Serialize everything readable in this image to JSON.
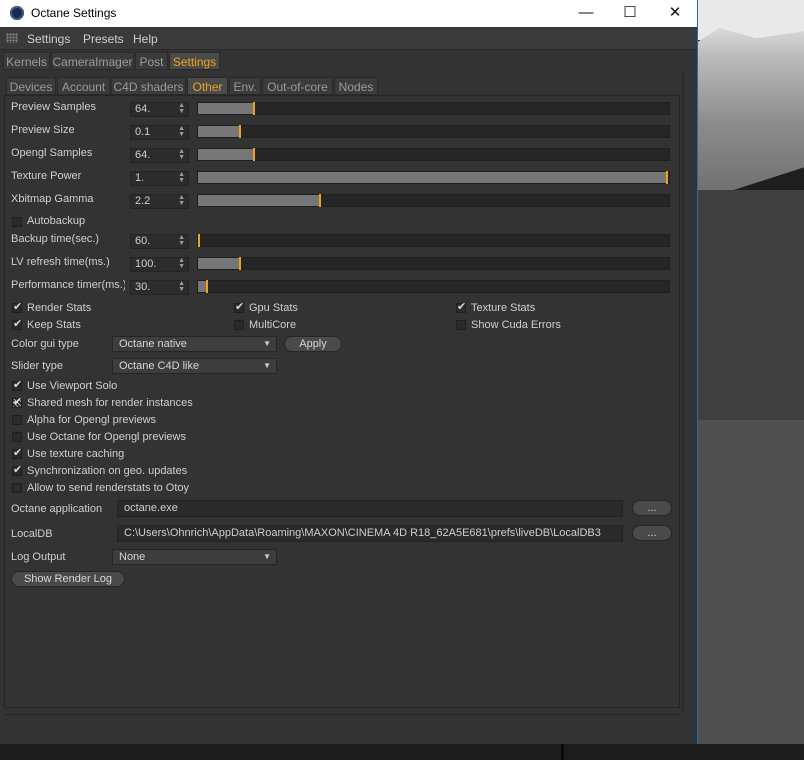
{
  "window": {
    "title": "Octane Settings",
    "minimize": "—",
    "maximize": "☐",
    "close": "✕"
  },
  "menubar": {
    "items": [
      "Settings",
      "Presets",
      "Help"
    ]
  },
  "main_tabs": [
    "Kernels",
    "CameraImager",
    "Post",
    "Settings"
  ],
  "main_tab_active": "Settings",
  "sub_tabs": [
    "Devices",
    "Account",
    "C4D shaders",
    "Other",
    "Env.",
    "Out-of-core",
    "Nodes"
  ],
  "sub_tab_active": "Other",
  "sliders": [
    {
      "label": "Preview Samples",
      "value": "64.",
      "fraction": 0.12
    },
    {
      "label": "Preview Size",
      "value": "0.1",
      "fraction": 0.09
    },
    {
      "label": "Opengl Samples",
      "value": "64.",
      "fraction": 0.12
    },
    {
      "label": "Texture Power",
      "value": "1.",
      "fraction": 1.0
    },
    {
      "label": "Xbitmap Gamma",
      "value": "2.2",
      "fraction": 0.26
    }
  ],
  "autobackup": {
    "label": "Autobackup",
    "checked": false
  },
  "sliders2": [
    {
      "label": "Backup time(sec.)",
      "value": "60.",
      "fraction": 0.0
    },
    {
      "label": "LV refresh time(ms.)",
      "value": "100.",
      "fraction": 0.09
    },
    {
      "label": "Performance timer(ms.)",
      "value": "30.",
      "fraction": 0.02
    }
  ],
  "stats": {
    "render_stats": {
      "label": "Render Stats",
      "checked": true
    },
    "gpu_stats": {
      "label": "Gpu Stats",
      "checked": true
    },
    "texture_stats": {
      "label": "Texture Stats",
      "checked": true
    },
    "keep_stats": {
      "label": "Keep Stats",
      "checked": true
    },
    "multicore": {
      "label": "MultiCore",
      "checked": false
    },
    "show_cuda_errors": {
      "label": "Show Cuda Errors",
      "checked": false
    }
  },
  "color_gui": {
    "label": "Color gui type",
    "value": "Octane native",
    "apply": "Apply"
  },
  "slider_type": {
    "label": "Slider type",
    "value": "Octane C4D like"
  },
  "options": [
    {
      "label": "Use Viewport Solo",
      "state": "checked"
    },
    {
      "label": "Shared mesh for render instances",
      "state": "mixed"
    },
    {
      "label": "Alpha for Opengl previews",
      "state": "unchecked"
    },
    {
      "label": "Use Octane for Opengl previews",
      "state": "unchecked"
    },
    {
      "label": "Use texture caching",
      "state": "checked"
    },
    {
      "label": "Synchronization on geo. updates",
      "state": "checked"
    },
    {
      "label": "Allow to send renderstats to Otoy",
      "state": "unchecked"
    }
  ],
  "octane_app": {
    "label": "Octane application",
    "value": "octane.exe",
    "browse": "..."
  },
  "localdb": {
    "label": "LocalDB",
    "value": "C:\\Users\\Ohnrich\\AppData\\Roaming\\MAXON\\CINEMA 4D R18_62A5E681\\prefs\\liveDB\\LocalDB3",
    "browse": "..."
  },
  "log_output": {
    "label": "Log Output",
    "value": "None"
  },
  "show_render_log": "Show Render Log",
  "colors": {
    "accent": "#f0a020",
    "panel": "#333333",
    "slider_fill": "#777777"
  }
}
